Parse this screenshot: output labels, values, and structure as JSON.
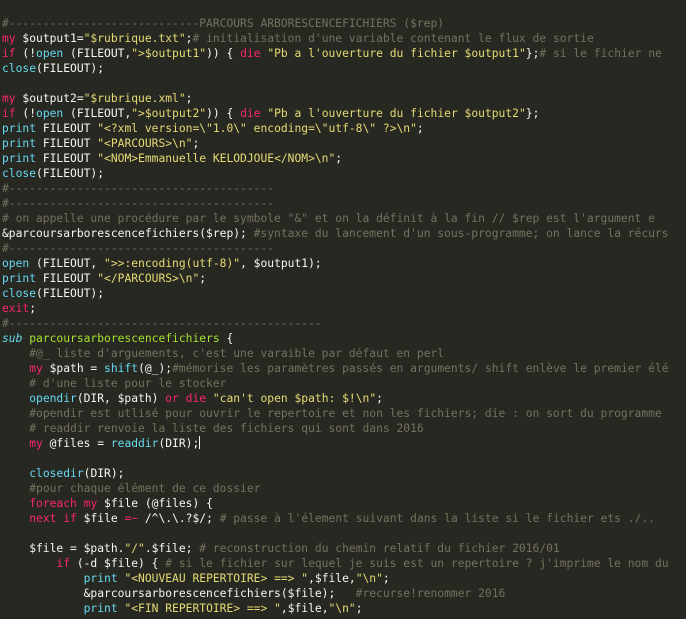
{
  "code_lines": [
    [
      [
        "c",
        "#----------------------------PARCOURS ARBORESCENCEFICHIERS ($rep)"
      ]
    ],
    [
      [
        "k",
        "my"
      ],
      [
        "v",
        " $output1="
      ],
      [
        "s",
        "\"$rubrique.txt\""
      ],
      [
        "v",
        ";"
      ],
      [
        "c",
        "# initialisation d'une variable contenant le flux de sortie"
      ]
    ],
    [
      [
        "k",
        "if"
      ],
      [
        "v",
        " (!"
      ],
      [
        "f",
        "open"
      ],
      [
        "v",
        " (FILEOUT,"
      ],
      [
        "s",
        "\">$output1\""
      ],
      [
        "v",
        ")) { "
      ],
      [
        "k",
        "die"
      ],
      [
        "v",
        " "
      ],
      [
        "s",
        "\"Pb a l'ouverture du fichier $output1\""
      ],
      [
        "v",
        "};"
      ],
      [
        "c",
        "# si le fichier ne"
      ]
    ],
    [
      [
        "f",
        "close"
      ],
      [
        "v",
        "(FILEOUT);"
      ]
    ],
    [
      [
        "v",
        ""
      ]
    ],
    [
      [
        "k",
        "my"
      ],
      [
        "v",
        " $output2="
      ],
      [
        "s",
        "\"$rubrique.xml\""
      ],
      [
        "v",
        ";"
      ]
    ],
    [
      [
        "k",
        "if"
      ],
      [
        "v",
        " (!"
      ],
      [
        "f",
        "open"
      ],
      [
        "v",
        " (FILEOUT,"
      ],
      [
        "s",
        "\">$output2\""
      ],
      [
        "v",
        ")) { "
      ],
      [
        "k",
        "die"
      ],
      [
        "v",
        " "
      ],
      [
        "s",
        "\"Pb a l'ouverture du fichier $output2\""
      ],
      [
        "v",
        "};"
      ]
    ],
    [
      [
        "f",
        "print"
      ],
      [
        "v",
        " FILEOUT "
      ],
      [
        "s",
        "\"<?xml version=\\\"1.0\\\" encoding=\\\"utf-8\\\" ?>\\n\""
      ],
      [
        "v",
        ";"
      ]
    ],
    [
      [
        "f",
        "print"
      ],
      [
        "v",
        " FILEOUT "
      ],
      [
        "s",
        "\"<PARCOURS>\\n\""
      ],
      [
        "v",
        ";"
      ]
    ],
    [
      [
        "f",
        "print"
      ],
      [
        "v",
        " FILEOUT "
      ],
      [
        "s",
        "\"<NOM>Emmanuelle KELODJOUE</NOM>\\n\""
      ],
      [
        "v",
        ";"
      ]
    ],
    [
      [
        "f",
        "close"
      ],
      [
        "v",
        "(FILEOUT);"
      ]
    ],
    [
      [
        "c",
        "#---------------------------------------"
      ]
    ],
    [
      [
        "c",
        "#---------------------------------------"
      ]
    ],
    [
      [
        "c",
        "# on appelle une procédure par le symbole \"&\" et on la définit à la fin // $rep est l'argument e"
      ]
    ],
    [
      [
        "v",
        "&parcoursarborescencefichiers($rep); "
      ],
      [
        "c",
        "#syntaxe du lancement d'un sous-programme; on lance la récurs"
      ]
    ],
    [
      [
        "c",
        "#---------------------------------------"
      ]
    ],
    [
      [
        "f",
        "open"
      ],
      [
        "v",
        " (FILEOUT, "
      ],
      [
        "s",
        "\">>:encoding(utf-8)\""
      ],
      [
        "v",
        ", $output1);"
      ]
    ],
    [
      [
        "f",
        "print"
      ],
      [
        "v",
        " FILEOUT "
      ],
      [
        "s",
        "\"</PARCOURS>\\n\""
      ],
      [
        "v",
        ";"
      ]
    ],
    [
      [
        "f",
        "close"
      ],
      [
        "v",
        "(FILEOUT);"
      ]
    ],
    [
      [
        "k",
        "exit"
      ],
      [
        "v",
        ";"
      ]
    ],
    [
      [
        "c",
        "#----------------------------------------------"
      ]
    ],
    [
      [
        "sub",
        "sub"
      ],
      [
        "v",
        " "
      ],
      [
        "fn",
        "parcoursarborescencefichiers"
      ],
      [
        "v",
        " {"
      ]
    ],
    [
      [
        "v",
        "    "
      ],
      [
        "c",
        "#@_ liste d'arguements, c'est une varaible par défaut en perl"
      ]
    ],
    [
      [
        "v",
        "    "
      ],
      [
        "k",
        "my"
      ],
      [
        "v",
        " $path = "
      ],
      [
        "f",
        "shift"
      ],
      [
        "v",
        "(@_);"
      ],
      [
        "c",
        "#mémorise les paramètres passés en arguments/ shift enlève le premier élé"
      ]
    ],
    [
      [
        "v",
        "    "
      ],
      [
        "c",
        "# d'une liste pour le stocker"
      ]
    ],
    [
      [
        "v",
        "    "
      ],
      [
        "f",
        "opendir"
      ],
      [
        "v",
        "(DIR, $path) "
      ],
      [
        "k",
        "or"
      ],
      [
        "v",
        " "
      ],
      [
        "k",
        "die"
      ],
      [
        "v",
        " "
      ],
      [
        "s",
        "\"can't open $path: $!\\n\""
      ],
      [
        "v",
        ";"
      ]
    ],
    [
      [
        "v",
        "    "
      ],
      [
        "c",
        "#opendir est utlisé pour ouvrir le repertoire et non les fichiers; die : on sort du programme"
      ]
    ],
    [
      [
        "v",
        "    "
      ],
      [
        "c",
        "# readdir renvoie la liste des fichiers qui sont dans 2016"
      ]
    ],
    [
      [
        "v",
        "    "
      ],
      [
        "k",
        "my"
      ],
      [
        "v",
        " @files = "
      ],
      [
        "f",
        "readdir"
      ],
      [
        "v",
        "(DIR);"
      ],
      [
        "cursor",
        ""
      ]
    ],
    [
      [
        "v",
        ""
      ]
    ],
    [
      [
        "v",
        "    "
      ],
      [
        "f",
        "closedir"
      ],
      [
        "v",
        "(DIR);"
      ]
    ],
    [
      [
        "v",
        "    "
      ],
      [
        "c",
        "#pour chaque élément de ce dossier"
      ]
    ],
    [
      [
        "v",
        "    "
      ],
      [
        "k",
        "foreach"
      ],
      [
        "v",
        " "
      ],
      [
        "k",
        "my"
      ],
      [
        "v",
        " $file (@files) {"
      ]
    ],
    [
      [
        "v",
        "    "
      ],
      [
        "k",
        "next"
      ],
      [
        "v",
        " "
      ],
      [
        "k",
        "if"
      ],
      [
        "v",
        " $file "
      ],
      [
        "k",
        "=~"
      ],
      [
        "v",
        " /^\\.\\.?$/; "
      ],
      [
        "c",
        "# passe à l'élement suivant dans la liste si le fichier ets ./.."
      ]
    ],
    [
      [
        "v",
        ""
      ]
    ],
    [
      [
        "v",
        "    $file = $path."
      ],
      [
        "s",
        "\"/\""
      ],
      [
        "v",
        ".$file; "
      ],
      [
        "c",
        "# reconstruction du chemin relatif du fichier 2016/01"
      ]
    ],
    [
      [
        "v",
        "        "
      ],
      [
        "k",
        "if"
      ],
      [
        "v",
        " (-d $file) { "
      ],
      [
        "c",
        "# si le fichier sur lequel je suis est un repertoire ? j'imprime le nom du"
      ]
    ],
    [
      [
        "v",
        "            "
      ],
      [
        "f",
        "print"
      ],
      [
        "v",
        " "
      ],
      [
        "s",
        "\"<NOUVEAU REPERTOIRE> ==> \""
      ],
      [
        "v",
        ",$file,"
      ],
      [
        "s",
        "\"\\n\""
      ],
      [
        "v",
        ";"
      ]
    ],
    [
      [
        "v",
        "            &parcoursarborescencefichiers($file);   "
      ],
      [
        "c",
        "#recurse!renommer 2016"
      ]
    ],
    [
      [
        "v",
        "            "
      ],
      [
        "f",
        "print"
      ],
      [
        "v",
        " "
      ],
      [
        "s",
        "\"<FIN REPERTOIRE> ==> \""
      ],
      [
        "v",
        ",$file,"
      ],
      [
        "s",
        "\"\\n\""
      ],
      [
        "v",
        ";"
      ]
    ]
  ]
}
